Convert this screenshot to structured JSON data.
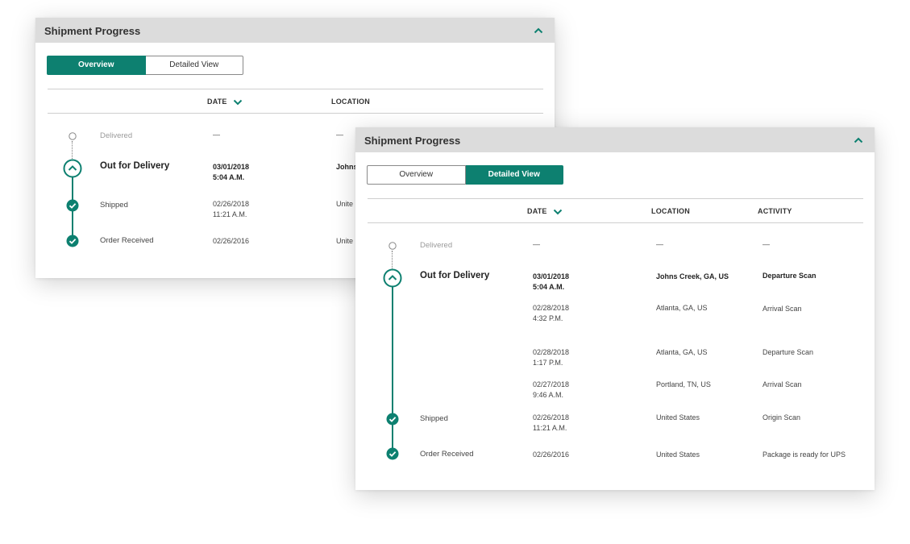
{
  "panels": [
    {
      "title": "Shipment Progress",
      "tabs": {
        "overview": "Overview",
        "detailed": "Detailed View",
        "active": "overview"
      },
      "columns": {
        "date": "DATE",
        "location": "LOCATION"
      },
      "rows": [
        {
          "status": "Delivered",
          "date": "—",
          "time": "",
          "location": "—"
        },
        {
          "status": "Out for Delivery",
          "date": "03/01/2018",
          "time": "5:04 A.M.",
          "location": "Johns"
        },
        {
          "status": "Shipped",
          "date": "02/26/2018",
          "time": "11:21 A.M.",
          "location": "Unite"
        },
        {
          "status": "Order Received",
          "date": "02/26/2016",
          "time": "",
          "location": "Unite"
        }
      ]
    },
    {
      "title": "Shipment Progress",
      "tabs": {
        "overview": "Overview",
        "detailed": "Detailed View",
        "active": "detailed"
      },
      "columns": {
        "date": "DATE",
        "location": "LOCATION",
        "activity": "ACTIVITY"
      },
      "rows": [
        {
          "status": "Delivered",
          "date": "—",
          "time": "",
          "location": "—",
          "activity": "—"
        },
        {
          "status": "Out for Delivery",
          "date": "03/01/2018",
          "time": "5:04 A.M.",
          "location": "Johns Creek, GA, US",
          "activity": "Departure Scan"
        },
        {
          "status": "",
          "date": "02/28/2018",
          "time": "4:32 P.M.",
          "location": "Atlanta, GA, US",
          "activity": "Arrival Scan"
        },
        {
          "status": "",
          "date": "02/28/2018",
          "time": "1:17 P.M.",
          "location": "Atlanta, GA, US",
          "activity": "Departure Scan"
        },
        {
          "status": "",
          "date": "02/27/2018",
          "time": "9:46 A.M.",
          "location": "Portland, TN, US",
          "activity": "Arrival Scan"
        },
        {
          "status": "Shipped",
          "date": "02/26/2018",
          "time": "11:21 A.M.",
          "location": "United States",
          "activity": "Origin Scan"
        },
        {
          "status": "Order Received",
          "date": "02/26/2016",
          "time": "",
          "location": "United States",
          "activity": "Package is ready for UPS"
        }
      ]
    }
  ],
  "colors": {
    "accent": "#0d8070",
    "header_bg": "#dcdcdc",
    "pending": "#9a9a9a"
  },
  "icons": {
    "collapse": "chevron-up-icon",
    "sort": "chevron-down-icon",
    "current": "chevron-up-circle-icon",
    "done": "check-circle-icon",
    "pending": "empty-circle-icon"
  }
}
